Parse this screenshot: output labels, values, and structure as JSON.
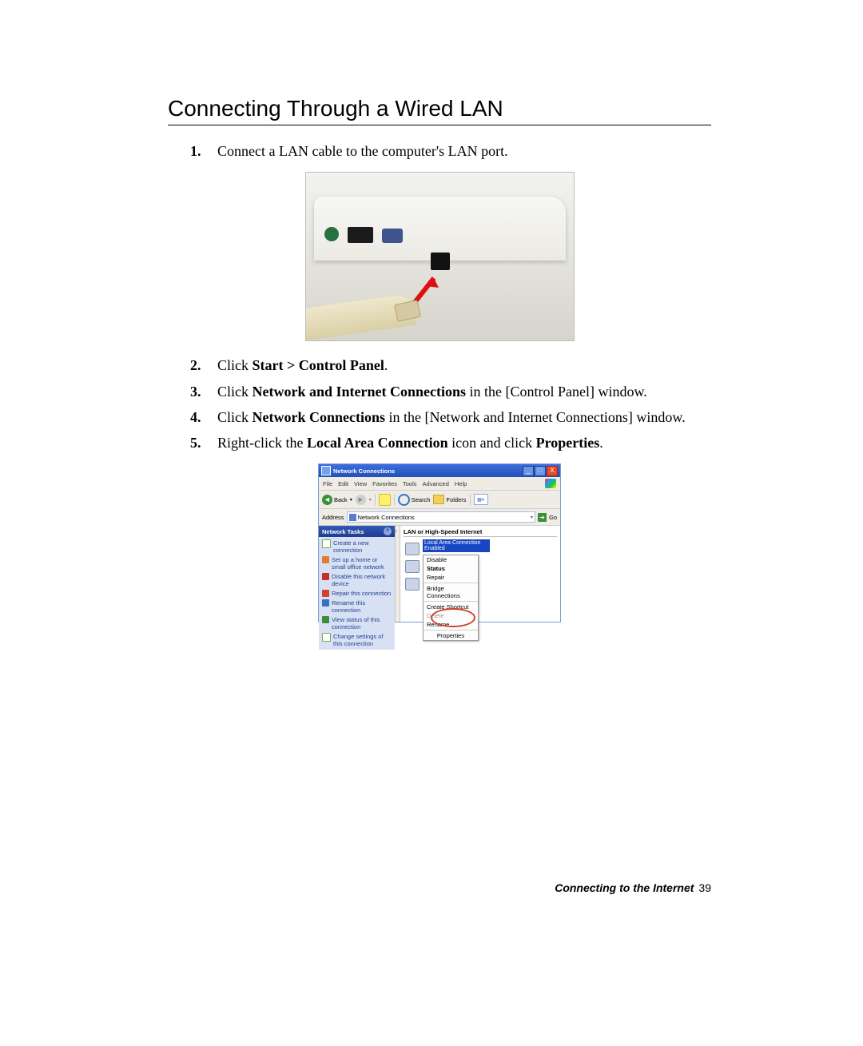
{
  "heading": "Connecting Through a Wired LAN",
  "steps": {
    "s1": {
      "num": "1.",
      "p1": "Connect a LAN cable to the computer's LAN port."
    },
    "s2": {
      "num": "2.",
      "p1": "Click ",
      "b1": "Start > Control Panel",
      "p2": "."
    },
    "s3": {
      "num": "3.",
      "p1": "Click ",
      "b1": "Network and Internet Connections",
      "p2": " in the [Control Panel] window."
    },
    "s4": {
      "num": "4.",
      "p1": "Click ",
      "b1": "Network Connections",
      "p2": " in the [Network and Internet Connections] window."
    },
    "s5": {
      "num": "5.",
      "p1": "Right-click the ",
      "b1": "Local Area Connection",
      "p2": " icon and click ",
      "b2": "Properties",
      "p3": "."
    }
  },
  "netwin": {
    "title": "Network Connections",
    "menus": {
      "file": "File",
      "edit": "Edit",
      "view": "View",
      "favorites": "Favorites",
      "tools": "Tools",
      "advanced": "Advanced",
      "help": "Help"
    },
    "toolbar": {
      "back": "Back",
      "search": "Search",
      "folders": "Folders"
    },
    "addr": {
      "label": "Address",
      "value": "Network Connections",
      "go": "Go"
    },
    "tasks_header": "Network Tasks",
    "tasks": {
      "create": "Create a new connection",
      "home": "Set up a home or small office network",
      "disable": "Disable this network device",
      "repair": "Repair this connection",
      "rename": "Rename this connection",
      "view": "View status of this connection",
      "change": "Change settings of this connection"
    },
    "section": "LAN or High-Speed Internet",
    "selected": "Local Area Connection Enabled",
    "ctx": {
      "disable": "Disable",
      "status": "Status",
      "repair": "Repair",
      "bridge": "Bridge Connections",
      "shortcut": "Create Shortcut",
      "delete": "Delete",
      "rename": "Rename",
      "properties": "Properties"
    }
  },
  "footer": {
    "section": "Connecting to the Internet",
    "page": "39"
  }
}
